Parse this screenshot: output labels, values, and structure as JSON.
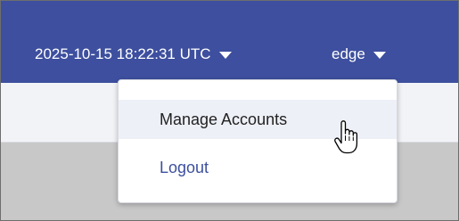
{
  "header": {
    "timestamp": "2025-10-15 18:22:31 UTC",
    "timestamp_caret_icon": "caret-down-icon",
    "username": "edge",
    "username_caret_icon": "caret-down-icon"
  },
  "account_menu": {
    "items": [
      {
        "label": "Manage Accounts",
        "state": "hovered"
      },
      {
        "label": "Logout"
      }
    ]
  },
  "cursor": {
    "icon": "hand-pointer-icon"
  },
  "colors": {
    "header_bg": "#3d4f9e",
    "link": "#3d4f9e",
    "hover_bg": "#eef0f8"
  }
}
